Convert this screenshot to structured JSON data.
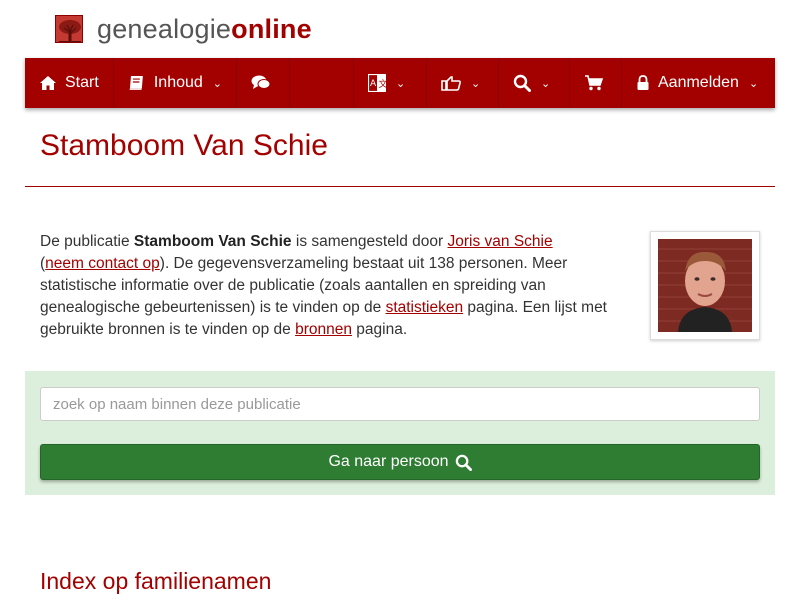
{
  "brand": {
    "part1": "genealogie",
    "part2": "online"
  },
  "nav": {
    "start": "Start",
    "inhoud": "Inhoud",
    "aanmelden": "Aanmelden"
  },
  "page": {
    "title": "Stamboom Van Schie"
  },
  "intro": {
    "t1": "De publicatie ",
    "pub": "Stamboom Van Schie",
    "t2": " is samengesteld door ",
    "author": "Joris van Schie",
    "t3": "(",
    "contact": "neem contact op",
    "t4": "). De gegevensverzameling bestaat uit 138 personen. Meer statistische informatie over de publicatie (zoals aantallen en spreiding van genealogische gebeurtenissen) is te vinden op de ",
    "stats": "statistieken",
    "t5": " pagina. Een lijst met gebruikte bronnen is te vinden op de ",
    "sources": "bronnen",
    "t6": " pagina."
  },
  "search": {
    "placeholder": "zoek op naam binnen deze publicatie",
    "button": "Ga naar persoon"
  },
  "index": {
    "title": "Index op familienamen"
  },
  "colors": {
    "brand": "#a30000",
    "panel": "#dcefdc",
    "button": "#2e7d32"
  }
}
